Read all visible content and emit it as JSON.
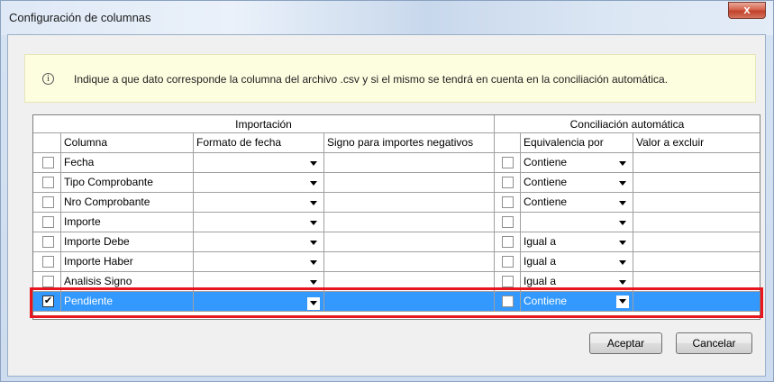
{
  "window": {
    "title": "Configuración de columnas",
    "close_label": "x"
  },
  "info": {
    "icon": "info-icon",
    "icon_glyph": "i",
    "text": "Indique a que dato corresponde la columna del archivo .csv y si el mismo se tendrá en cuenta en la conciliación automática."
  },
  "grid": {
    "group_headers": {
      "importacion": "Importación",
      "conciliacion": "Conciliación automática"
    },
    "columns": {
      "columna": "Columna",
      "formato_fecha": "Formato de  fecha",
      "signo": "Signo para importes negativos",
      "equivalencia": "Equivalencia por",
      "valor_excluir": "Valor a excluir"
    },
    "rows": [
      {
        "checked": false,
        "columna": "Fecha",
        "formato": "",
        "signo": "",
        "conc_checked": false,
        "equivalencia": "Contiene",
        "valor": "",
        "selected": false
      },
      {
        "checked": false,
        "columna": "Tipo Comprobante",
        "formato": "",
        "signo": "",
        "conc_checked": false,
        "equivalencia": "Contiene",
        "valor": "",
        "selected": false
      },
      {
        "checked": false,
        "columna": "Nro Comprobante",
        "formato": "",
        "signo": "",
        "conc_checked": false,
        "equivalencia": "Contiene",
        "valor": "",
        "selected": false
      },
      {
        "checked": false,
        "columna": "Importe",
        "formato": "",
        "signo": "",
        "conc_checked": false,
        "equivalencia": "",
        "valor": "",
        "selected": false
      },
      {
        "checked": false,
        "columna": "Importe Debe",
        "formato": "",
        "signo": "",
        "conc_checked": false,
        "equivalencia": "Igual a",
        "valor": "",
        "selected": false
      },
      {
        "checked": false,
        "columna": "Importe Haber",
        "formato": "",
        "signo": "",
        "conc_checked": false,
        "equivalencia": "Igual a",
        "valor": "",
        "selected": false
      },
      {
        "checked": false,
        "columna": "Analisis Signo",
        "formato": "",
        "signo": "",
        "conc_checked": false,
        "equivalencia": "Igual a",
        "valor": "",
        "selected": false
      },
      {
        "checked": true,
        "columna": "Pendiente",
        "formato": "",
        "signo": "",
        "conc_checked": false,
        "equivalencia": "Contiene",
        "valor": "",
        "selected": true
      }
    ]
  },
  "buttons": {
    "accept": "Aceptar",
    "cancel": "Cancelar"
  },
  "colors": {
    "selection": "#3399ff",
    "highlight_border": "#e8141e",
    "info_background": "#fdfde0"
  }
}
